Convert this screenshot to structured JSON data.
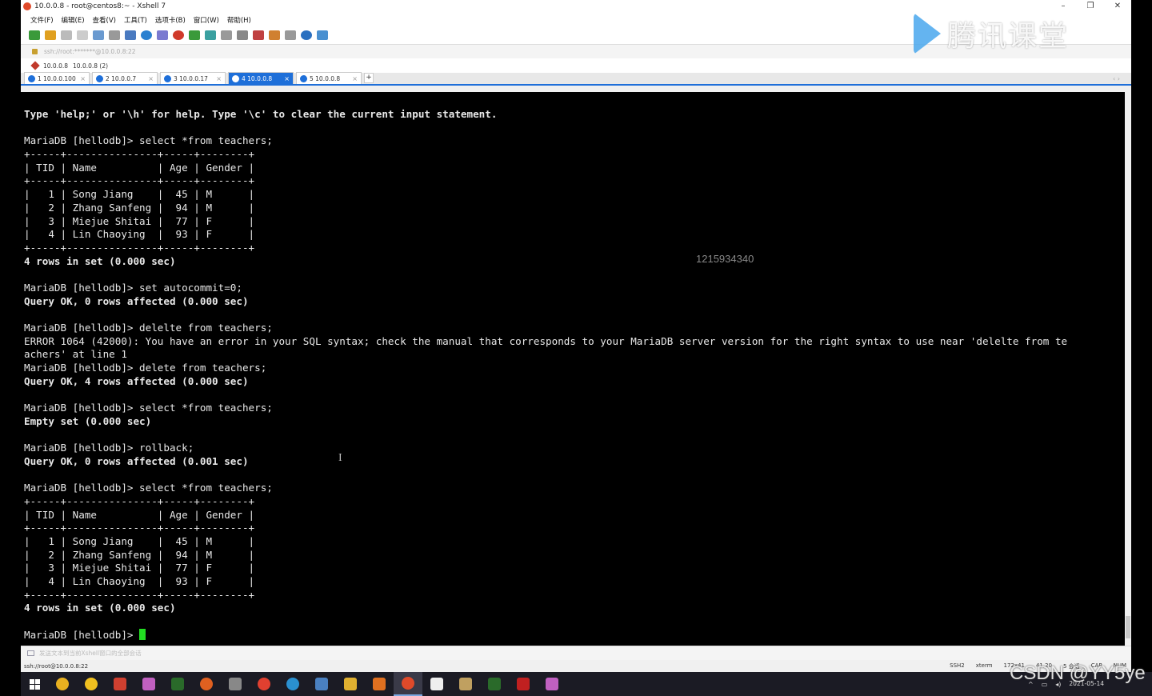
{
  "window": {
    "title": "10.0.0.8 - root@centos8:~ - Xshell 7",
    "controls": [
      "–",
      "❐",
      "✕"
    ]
  },
  "menu": [
    "文件(F)",
    "编辑(E)",
    "查看(V)",
    "工具(T)",
    "选项卡(B)",
    "窗口(W)",
    "帮助(H)"
  ],
  "address": "ssh://root:*******@10.0.0.8:22",
  "session_path": [
    "10.0.0.8",
    "10.0.0.8 (2)"
  ],
  "tabs": [
    {
      "label": "1 10.0.0.100",
      "active": false
    },
    {
      "label": "2 10.0.0.7",
      "active": false
    },
    {
      "label": "3 10.0.0.17",
      "active": false
    },
    {
      "label": "4 10.0.0.8",
      "active": true
    },
    {
      "label": "5 10.0.0.8",
      "active": false
    }
  ],
  "tab_add": "+",
  "tab_nav": "‹ ›",
  "brand": "腾讯课堂",
  "terminal": {
    "lines": [
      {
        "text": "Type 'help;' or '\\h' for help. Type '\\c' to clear the current input statement.",
        "bold": true
      },
      {
        "text": "",
        "bold": false
      },
      {
        "text": "MariaDB [hellodb]> select *from teachers;",
        "bold": false
      },
      {
        "text": "+-----+---------------+-----+--------+",
        "bold": false
      },
      {
        "text": "| TID | Name          | Age | Gender |",
        "bold": false
      },
      {
        "text": "+-----+---------------+-----+--------+",
        "bold": false
      },
      {
        "text": "|   1 | Song Jiang    |  45 | M      |",
        "bold": false
      },
      {
        "text": "|   2 | Zhang Sanfeng |  94 | M      |",
        "bold": false
      },
      {
        "text": "|   3 | Miejue Shitai |  77 | F      |",
        "bold": false
      },
      {
        "text": "|   4 | Lin Chaoying  |  93 | F      |",
        "bold": false
      },
      {
        "text": "+-----+---------------+-----+--------+",
        "bold": false
      },
      {
        "text": "4 rows in set (0.000 sec)",
        "bold": true
      },
      {
        "text": "",
        "bold": false
      },
      {
        "text": "MariaDB [hellodb]> set autocommit=0;",
        "bold": false
      },
      {
        "text": "Query OK, 0 rows affected (0.000 sec)",
        "bold": true
      },
      {
        "text": "",
        "bold": false
      },
      {
        "text": "MariaDB [hellodb]> delelte from teachers;",
        "bold": false
      },
      {
        "text": "ERROR 1064 (42000): You have an error in your SQL syntax; check the manual that corresponds to your MariaDB server version for the right syntax to use near 'delelte from te",
        "bold": false
      },
      {
        "text": "achers' at line 1",
        "bold": false
      },
      {
        "text": "MariaDB [hellodb]> delete from teachers;",
        "bold": false
      },
      {
        "text": "Query OK, 4 rows affected (0.000 sec)",
        "bold": true
      },
      {
        "text": "",
        "bold": false
      },
      {
        "text": "MariaDB [hellodb]> select *from teachers;",
        "bold": false
      },
      {
        "text": "Empty set (0.000 sec)",
        "bold": true
      },
      {
        "text": "",
        "bold": false
      },
      {
        "text": "MariaDB [hellodb]> rollback;",
        "bold": false
      },
      {
        "text": "Query OK, 0 rows affected (0.001 sec)",
        "bold": true
      },
      {
        "text": "",
        "bold": false
      },
      {
        "text": "MariaDB [hellodb]> select *from teachers;",
        "bold": false
      },
      {
        "text": "+-----+---------------+-----+--------+",
        "bold": false
      },
      {
        "text": "| TID | Name          | Age | Gender |",
        "bold": false
      },
      {
        "text": "+-----+---------------+-----+--------+",
        "bold": false
      },
      {
        "text": "|   1 | Song Jiang    |  45 | M      |",
        "bold": false
      },
      {
        "text": "|   2 | Zhang Sanfeng |  94 | M      |",
        "bold": false
      },
      {
        "text": "|   3 | Miejue Shitai |  77 | F      |",
        "bold": false
      },
      {
        "text": "|   4 | Lin Chaoying  |  93 | F      |",
        "bold": false
      },
      {
        "text": "+-----+---------------+-----+--------+",
        "bold": false
      },
      {
        "text": "4 rows in set (0.000 sec)",
        "bold": true
      },
      {
        "text": "",
        "bold": false
      }
    ],
    "prompt": "MariaDB [hellodb]> ",
    "overlay_number": "1215934340",
    "cursor_glyph": "I"
  },
  "hint": "发送文本到当前Xshell窗口的全部会话",
  "status": {
    "left": "ssh://root@10.0.0.8:22",
    "items": [
      "SSH2",
      "xterm",
      "172x41",
      "41,20",
      "5 会话",
      "CAP",
      "NUM"
    ]
  },
  "taskbar": {
    "date": "2021-05-14",
    "time": "",
    "watermark": "CSDN @YY5ye"
  },
  "colors": {
    "terminal_bg": "#000000",
    "terminal_fg": "#e8e8e8",
    "cursor": "#22dd22",
    "accent": "#1e6fd9"
  }
}
